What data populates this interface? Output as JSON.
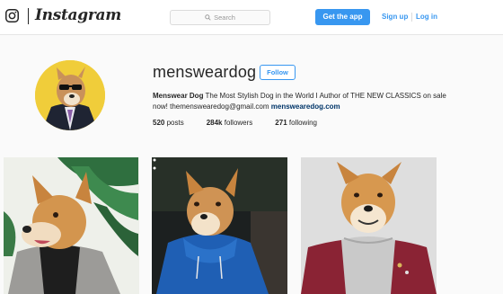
{
  "header": {
    "logo_text": "Instagram",
    "search_placeholder": "Search",
    "get_app_label": "Get the app",
    "signup_label": "Sign up",
    "login_label": "Log in"
  },
  "profile": {
    "username": "mensweardog",
    "follow_label": "Follow",
    "bio_name": "Menswear Dog",
    "bio_text": " The Most Stylish Dog in the World I Author of THE NEW CLASSICS on sale now! themenswearedog@gmail.com ",
    "bio_link": "menswearedog.com",
    "posts_count": "520",
    "posts_label": " posts",
    "followers_count": "284k",
    "followers_label": " followers",
    "following_count": "271",
    "following_label": " following"
  },
  "posts": [
    {
      "subject": "shiba dog in grey blazer and black turtleneck"
    },
    {
      "subject": "shiba dog in blue hooded jacket"
    },
    {
      "subject": "shiba dog in maroon bomber jacket and grey tee"
    }
  ],
  "colors": {
    "accent": "#3897f0",
    "link": "#003569",
    "text": "#262626",
    "background": "#fafafa"
  }
}
